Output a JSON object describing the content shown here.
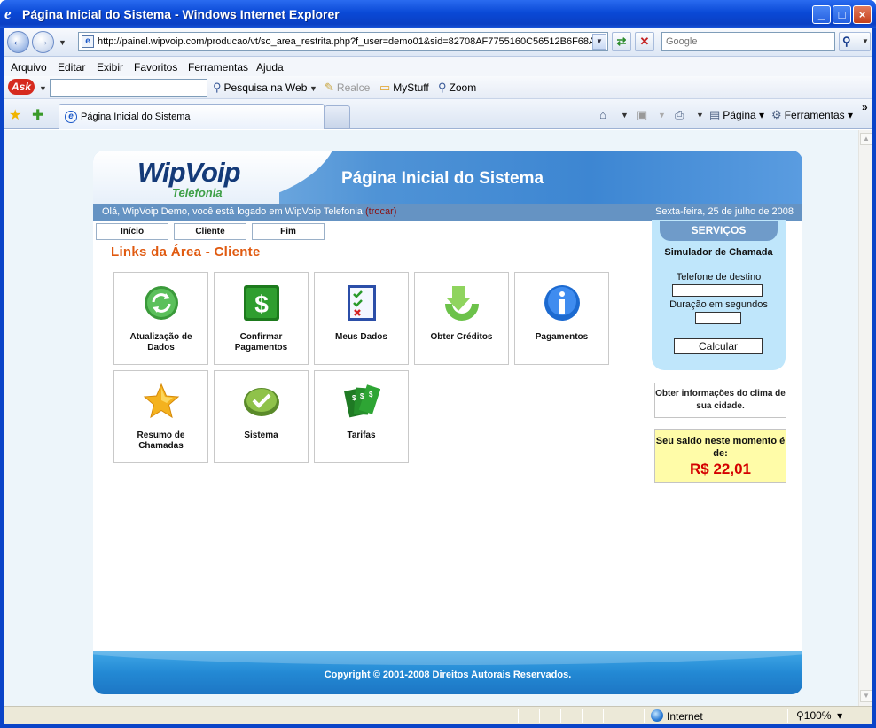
{
  "window": {
    "title": "Página Inicial do Sistema - Windows Internet Explorer",
    "url": "http://painel.wipvoip.com/producao/vt/so_area_restrita.php?f_user=demo01&sid=82708AF7755160C56512B6F68A",
    "search_placeholder": "Google"
  },
  "menu": [
    "Arquivo",
    "Editar",
    "Exibir",
    "Favoritos",
    "Ferramentas",
    "Ajuda"
  ],
  "ask_toolbar": {
    "logo": "Ask",
    "search_web": "Pesquisa na Web",
    "highlight": "Realce",
    "mystuff": "MyStuff",
    "zoom": "Zoom"
  },
  "tabs": {
    "active_label": "Página Inicial do Sistema"
  },
  "command_bar": {
    "page": "Página",
    "tools": "Ferramentas"
  },
  "status": {
    "zone": "Internet",
    "zoom": "100%"
  },
  "site": {
    "logo_main": "WipVoip",
    "logo_sub": "Telefonia",
    "title": "Página Inicial do Sistema",
    "greeting": "Olá, WipVoip Demo, você está logado em WipVoip Telefonia",
    "trocar": "(trocar)",
    "date": "Sexta-feira, 25 de julho de 2008",
    "nav": [
      "Início",
      "Cliente",
      "Fim"
    ],
    "section_title": "Links da Área - Cliente",
    "tiles": [
      {
        "label": "Atualização de Dados",
        "icon": "refresh-icon"
      },
      {
        "label": "Confirmar Pagamentos",
        "icon": "dollar-icon"
      },
      {
        "label": "Meus Dados",
        "icon": "checklist-icon"
      },
      {
        "label": "Obter Créditos",
        "icon": "download-arrow-icon"
      },
      {
        "label": "Pagamentos",
        "icon": "info-icon"
      },
      {
        "label": "Resumo de Chamadas",
        "icon": "star-icon"
      },
      {
        "label": "Sistema",
        "icon": "check-icon"
      },
      {
        "label": "Tarifas",
        "icon": "money-icon"
      }
    ],
    "services": {
      "heading": "SERVIÇOS",
      "simulator_title": "Simulador de Chamada",
      "phone_label": "Telefone de destino",
      "phone_value": "",
      "duration_label": "Duração em segundos",
      "duration_value": "",
      "calc_button": "Calcular"
    },
    "weather_text": "Obter informações do clima de sua cidade.",
    "balance_label": "Seu saldo neste momento é de:",
    "balance_value": "R$ 22,01",
    "footer": "Copyright © 2001-2008 Direitos Autorais Reservados."
  }
}
